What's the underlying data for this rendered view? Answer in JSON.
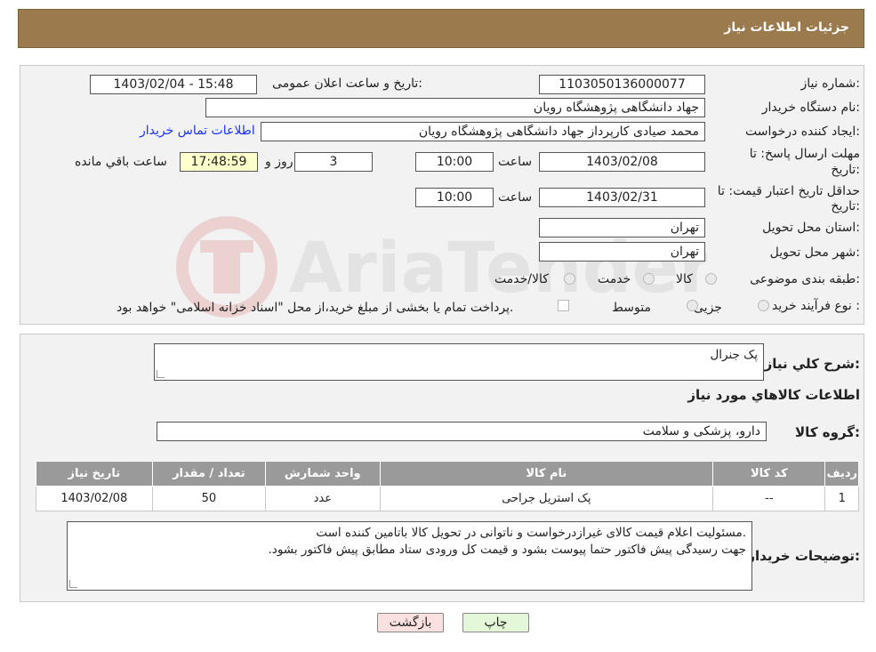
{
  "header": {
    "title": "جزئیات اطلاعات نیاز"
  },
  "form": {
    "need_number_label": "شماره نیاز:",
    "need_number": "1103050136000077",
    "announce_label": "تاریخ و ساعت اعلان عمومی:",
    "announce_value": "1403/02/04 - 15:48",
    "buyer_label": "نام دستگاه خریدار:",
    "buyer": "جهاد دانشگاهی پژوهشگاه رویان",
    "creator_label": "ایجاد کننده درخواست:",
    "creator": "محمد صیادی کارپرداز جهاد دانشگاهی پژوهشگاه رویان",
    "contact_link": "اطلاعات تماس خریدار",
    "deadline_label_1": "مهلت ارسال پاسخ: تا",
    "deadline_label_2": "تاریخ:",
    "deadline_date": "1403/02/08",
    "time_label": "ساعت",
    "deadline_time": "10:00",
    "days": "3",
    "days_label": "روز و",
    "remaining_time": "17:48:59",
    "remaining_label": "ساعت باقي مانده",
    "validity_label_1": "حداقل تاریخ اعتبار قیمت: تا",
    "validity_label_2": "تاریخ:",
    "validity_date": "1403/02/31",
    "validity_time_label": "ساعت",
    "validity_time": "10:00",
    "province_label": "استان محل تحویل:",
    "province": "تهران",
    "city_label": "شهر محل تحویل:",
    "city": "تهران",
    "category_label": "طبقه بندی موضوعی:",
    "category_options": [
      "کالا",
      "خدمت",
      "کالا/خدمت"
    ],
    "process_label": "نوع فرآیند خرید :",
    "process_options": [
      "جزیی",
      "متوسط"
    ],
    "payment_note": "پرداخت تمام یا بخشی از مبلغ خرید،از محل \"اسناد خزانه اسلامی\" خواهد بود."
  },
  "details": {
    "general_desc_label": "شرح کلي نیاز:",
    "general_desc": "پک جنرال",
    "items_title": "اطلاعات کالاهاي مورد نیاز",
    "group_label": "گروه کالا:",
    "group": "دارو، پزشکی و سلامت",
    "table": {
      "headers": [
        "ردیف",
        "کد کالا",
        "نام کالا",
        "واحد شمارش",
        "تعداد / مقدار",
        "تاریخ نیاز"
      ],
      "rows": [
        [
          "1",
          "--",
          "پک استریل جراحی",
          "عدد",
          "50",
          "1403/02/08"
        ]
      ]
    },
    "buyer_notes_label": "توضیحات خریدار:",
    "buyer_notes_line1": ".مسئولیت اعلام قیمت کالای غیرازدرخواست و ناتوانی در تحویل کالا باتامین کننده است",
    "buyer_notes_line2": "جهت رسیدگی پیش فاکتور حتما پیوست بشود و قیمت کل ورودی ستاد مطابق پیش فاکتور بشود."
  },
  "buttons": {
    "print": "چاپ",
    "back": "بازگشت"
  },
  "colors": {
    "header": "#9b7b4d",
    "link": "#1a33ff",
    "print_btn": "#e4f7d8",
    "back_btn": "#fbe0e0"
  }
}
